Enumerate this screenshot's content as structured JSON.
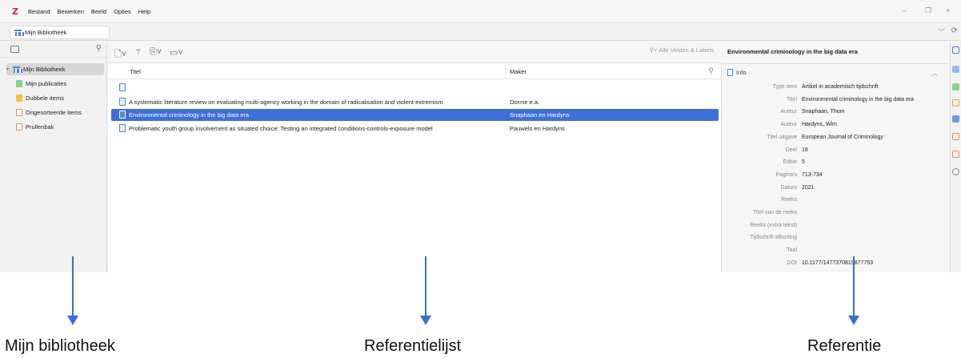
{
  "app": {
    "logo": "Z"
  },
  "menubar": {
    "items": [
      "Bestand",
      "Bewerken",
      "Beeld",
      "Opties",
      "Help"
    ]
  },
  "window_controls": {
    "minimize": "–",
    "restore": "❐",
    "close": "×"
  },
  "tab": {
    "label": "Mijn Bibliotheek"
  },
  "collections": [
    {
      "label": "Mijn Bibliotheek",
      "color": "#4a7fd1",
      "selected": true
    },
    {
      "label": "Mijn publicaties",
      "color": "#8ad28a",
      "selected": false
    },
    {
      "label": "Dubbele items",
      "color": "#f5c23e",
      "selected": false
    },
    {
      "label": "Ongesorteerde items",
      "color": "#f08a5d",
      "selected": false
    },
    {
      "label": "Prullenbak",
      "color": "#f08a5d",
      "selected": false
    }
  ],
  "search": {
    "placeholder": "Alle Velden & Labels"
  },
  "columns": {
    "title": "Titel",
    "creator": "Maker"
  },
  "items": [
    {
      "title": "",
      "creator": "",
      "selected": false
    },
    {
      "title": "A systematic literature review on evaluating multi-agency working in the domain of radicalisation and violent extremism",
      "creator": "Dorme e.a.",
      "selected": false
    },
    {
      "title": "Environmental criminology in the big data era",
      "creator": "Snaphaan en Hardyns",
      "selected": true
    },
    {
      "title": "Problematic youth group involvement as situated choice: Testing an integrated conditions-controls-exposure model",
      "creator": "Pauwels en Hardyns",
      "selected": false
    }
  ],
  "detail": {
    "title": "Environmental criminology in the big data era",
    "section": "Info",
    "fields": [
      {
        "label": "Type item",
        "value": "Artikel in academisch tijdschrift"
      },
      {
        "label": "Titel",
        "value": "Environmental criminology in the big data era"
      },
      {
        "label": "Auteur",
        "value": "Snaphaan, Thom"
      },
      {
        "label": "Auteur",
        "value": "Hardyns, Wim"
      },
      {
        "label": "Titel uitgave",
        "value": "European Journal of Criminology"
      },
      {
        "label": "Deel",
        "value": "18"
      },
      {
        "label": "Editie",
        "value": "5"
      },
      {
        "label": "Pagina's",
        "value": "713-734"
      },
      {
        "label": "Datum",
        "value": "2021"
      },
      {
        "label": "Reeks",
        "value": ""
      },
      {
        "label": "Titel van de reeks",
        "value": ""
      },
      {
        "label": "Reeks (extra tekst)",
        "value": ""
      },
      {
        "label": "Tijdschrift-afkorting",
        "value": ""
      },
      {
        "label": "Taal",
        "value": ""
      },
      {
        "label": "DOI",
        "value": "10.1177/1477370819877753"
      }
    ]
  },
  "annotations": {
    "left": "Mijn bibliotheek",
    "middle": "Referentielijst",
    "right": "Referentie"
  },
  "colors": {
    "accent": "#3f6fd8",
    "brand": "#cc2936",
    "arrow": "#3a6fd0"
  }
}
